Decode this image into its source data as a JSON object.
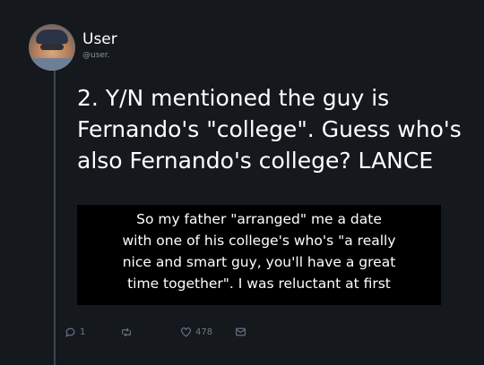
{
  "author": {
    "name": "User",
    "handle": "@user."
  },
  "tweet": {
    "text": "2. Y/N mentioned the guy is\nFernando's \"college\". Guess who's\nalso Fernando's college? LANCE"
  },
  "quote": {
    "text": "So my father \"arranged\" me a date\nwith one of his college's who's \"a really\nnice and smart guy, you'll have a great\ntime together\". I was reluctant at first"
  },
  "actions": {
    "reply_count": "1",
    "retweet_count": "",
    "like_count": "478"
  },
  "icons": [
    "reply-icon",
    "retweet-icon",
    "like-icon",
    "message-icon"
  ],
  "colors": {
    "background": "#15181d",
    "icon": "#6c7a8c",
    "thread_line": "#3b4350"
  }
}
